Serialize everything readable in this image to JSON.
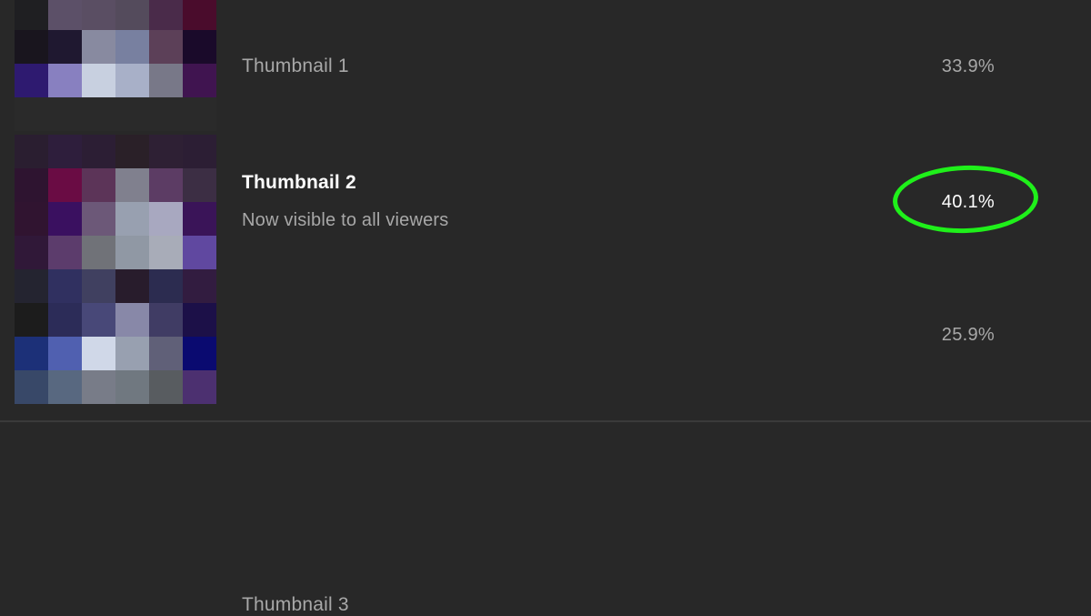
{
  "thumbnails": [
    {
      "label": "Thumbnail 1",
      "subtitle": "",
      "percent": "33.9%",
      "selected": false,
      "pixels": [
        "#1f1f22",
        "#5c5068",
        "#5a4e63",
        "#544b5c",
        "#4a2b4a",
        "#4a0c2c",
        "#19151e",
        "#1f1830",
        "#888aa0",
        "#7880a0",
        "#5c4058",
        "#1a0a2a",
        "#2e1a70",
        "#8880c0",
        "#c8d0e0",
        "#a8b0c8",
        "#787888",
        "#401450",
        "#2a2a2a",
        "#2a2a2a",
        "#2a2a2a",
        "#2a2a2a",
        "#2a2a2a",
        "#2a2a2a"
      ]
    },
    {
      "label": "Thumbnail 2",
      "subtitle": "Now visible to all viewers",
      "percent": "40.1%",
      "selected": true,
      "pixels": [
        "#2a1e30",
        "#2e1e3c",
        "#2c1e34",
        "#2a2028",
        "#2e2034",
        "#2c1e34",
        "#2e1430",
        "#6a0c44",
        "#5c3458",
        "#80808e",
        "#5c3c64",
        "#3c2e44",
        "#301430",
        "#3a1060",
        "#6c5878",
        "#98a0b0",
        "#a8a8c0",
        "#3a1458",
        "#301838",
        "#5c3c6c",
        "#707278",
        "#9098a4",
        "#a8acb8",
        "#6048a0"
      ]
    },
    {
      "label": "Thumbnail 3",
      "subtitle": "",
      "percent": "25.9%",
      "selected": false,
      "pixels": [
        "#242430",
        "#303060",
        "#404060",
        "#281c2c",
        "#2c2c50",
        "#321c40",
        "#1c1c1c",
        "#2c2c58",
        "#484878",
        "#8888a8",
        "#403c64",
        "#1c1048",
        "#1c3078",
        "#5060b0",
        "#d0d8e8",
        "#98a0b0",
        "#606078",
        "#0a0a70",
        "#384868",
        "#586880",
        "#787c88",
        "#707880",
        "#585c60",
        "#4c3070"
      ]
    }
  ],
  "highlight_color": "#1ff01a"
}
